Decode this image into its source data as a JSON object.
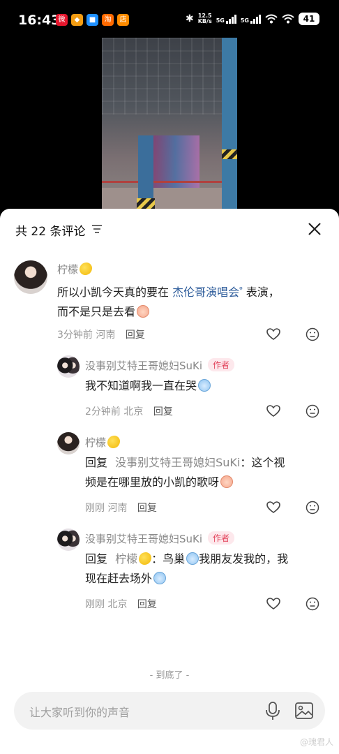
{
  "status_bar": {
    "time": "16:43",
    "network_speed_value": "12.5",
    "network_speed_unit": "KB/s",
    "sig1": "5G",
    "sig2": "5G",
    "battery": "41"
  },
  "comments_sheet": {
    "title": "共 22 条评论",
    "end_text": "- 到底了 -",
    "input_placeholder": "让大家听到你的声音",
    "watermark": "@瑰君人"
  },
  "comments": [
    {
      "author": "柠檬",
      "author_badge": "",
      "text_prefix": "所以小凯今天真的要在 ",
      "mention": "杰伦哥演唱会",
      "text_suffix": " 表演，",
      "text_line2": "而不是只是去看",
      "time": "3分钟前",
      "location": "河南",
      "reply_label": "回复"
    },
    {
      "author": "没事别艾特王哥媳妇SuKi",
      "author_badge": "作者",
      "text": "我不知道啊我一直在哭",
      "time": "2分钟前",
      "location": "北京",
      "reply_label": "回复"
    },
    {
      "author": "柠檬",
      "author_badge": "",
      "reply_prefix": "回复",
      "reply_to": "没事别艾特王哥媳妇SuKi",
      "text_line1": "：这个视",
      "text_line2": "频是在哪里放的小凯的歌呀",
      "time": "刚刚",
      "location": "河南",
      "reply_label": "回复"
    },
    {
      "author": "没事别艾特王哥媳妇SuKi",
      "author_badge": "作者",
      "reply_prefix": "回复",
      "reply_to": "柠檬",
      "text_line1a": "：鸟巢",
      "text_line1b": "我朋友发我的，我",
      "text_line2": "现在赶去场外",
      "time": "刚刚",
      "location": "北京",
      "reply_label": "回复"
    }
  ]
}
